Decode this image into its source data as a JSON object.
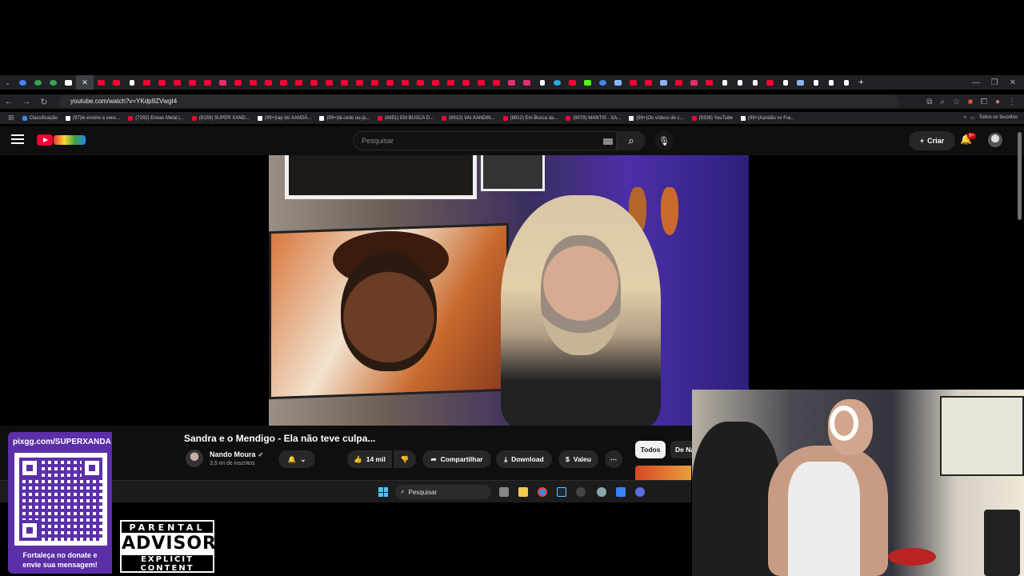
{
  "browser": {
    "url": "youtube.com/watch?v=YKdp9ZVwgI4",
    "bookmarks": [
      {
        "label": "Classificação",
        "kind": "g"
      },
      {
        "label": "(97)Ie ensino a venc...",
        "kind": "t"
      },
      {
        "label": "(7292) Enéas Metal |...",
        "kind": "y"
      },
      {
        "label": "(8159) SUPER XAND...",
        "kind": "y"
      },
      {
        "label": "(99+)rap do XANDÃ...",
        "kind": "t"
      },
      {
        "label": "(99+)tá cedo ou já...",
        "kind": "t"
      },
      {
        "label": "(8851) EM BUSCA D...",
        "kind": "y"
      },
      {
        "label": "(8912) VAI XANDIN...",
        "kind": "y"
      },
      {
        "label": "(8912) Em Busca da...",
        "kind": "y"
      },
      {
        "label": "(9078) MANTIS · XA...",
        "kind": "y"
      },
      {
        "label": "(99+)Os vídeos de c...",
        "kind": "t"
      },
      {
        "label": "(9338) YouTube",
        "kind": "y"
      },
      {
        "label": "(99+)Xandão vs Fra...",
        "kind": "t"
      }
    ],
    "all_bookmarks": "Todos os favoritos"
  },
  "youtube": {
    "search_placeholder": "Pesquisar",
    "create_label": "Criar",
    "notif_badge": "9+",
    "video_title": "Sandra e o Mendigo - Ela não teve culpa...",
    "channel_name": "Nando Moura",
    "channel_subs": "3,5 mi de inscritos",
    "likes": "14 mil",
    "share_label": "Compartilhar",
    "download_label": "Download",
    "thanks_label": "Valeu",
    "chips": [
      "Todos",
      "De Na"
    ]
  },
  "taskbar": {
    "search_placeholder": "Pesquisar"
  },
  "overlay": {
    "donate_url": "pixgg.com/SUPERXANDA",
    "donate_message_1": "Fortaleça no donate e",
    "donate_message_2": "envie sua mensagem!",
    "advisory_top": "PARENTAL",
    "advisory_mid": "ADVISORY",
    "advisory_bottom": "EXPLICIT CONTENT"
  },
  "colors": {
    "youtube_red": "#ff0033",
    "donate_purple": "#5b2fa8",
    "taskbar_accent": "#4cc2ff"
  }
}
